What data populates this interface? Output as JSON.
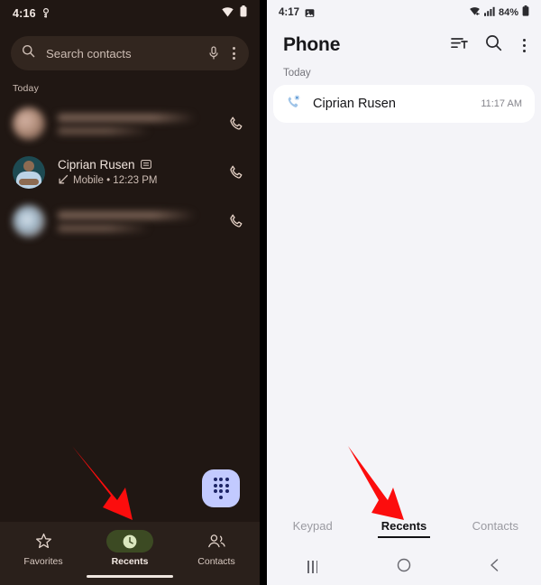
{
  "left_phone": {
    "status_bar": {
      "time": "4:16",
      "left_icon": "alarm-or-key-icon",
      "wifi_icon": "wifi-icon",
      "battery_icon": "battery-icon"
    },
    "search": {
      "placeholder": "Search contacts",
      "search_icon": "search-icon",
      "mic_icon": "microphone-icon",
      "overflow_icon": "more-vert-icon"
    },
    "section_header": "Today",
    "calls": [
      {
        "name": "",
        "subtitle": "",
        "blurred": true,
        "avatar": "blurred-avatar",
        "action_icon": "phone-icon"
      },
      {
        "name": "Ciprian Rusen",
        "badge_icon": "sim-card-icon",
        "direction_icon": "incoming-call-arrow",
        "subtitle": "Mobile • 12:23 PM",
        "blurred": false,
        "avatar": "contact-photo",
        "action_icon": "phone-icon"
      },
      {
        "name": "",
        "subtitle": "",
        "blurred": true,
        "avatar": "blurred-avatar",
        "action_icon": "phone-icon"
      }
    ],
    "fab": {
      "icon": "dialpad-icon",
      "color": "#c2caff"
    },
    "bottom_nav": [
      {
        "label": "Favorites",
        "icon": "star-icon",
        "active": false
      },
      {
        "label": "Recents",
        "icon": "clock-icon",
        "active": true
      },
      {
        "label": "Contacts",
        "icon": "people-icon",
        "active": false
      }
    ],
    "active_pill_color": "#3c4a23",
    "background_color": "#201713"
  },
  "right_phone": {
    "status_bar": {
      "time": "4:17",
      "left_icon": "screenshot-icon",
      "wifi_icon": "wifi-icon",
      "signal_icon": "cellular-signal-icon",
      "battery_text": "84%",
      "battery_icon": "battery-icon"
    },
    "header": {
      "title": "Phone",
      "sort_icon": "sort-icon",
      "search_icon": "search-icon",
      "overflow_icon": "more-vert-icon"
    },
    "section_header": "Today",
    "calls": [
      {
        "icon": "missed-call-icon",
        "name": "Ciprian Rusen",
        "time": "11:17 AM"
      }
    ],
    "tabs": [
      {
        "label": "Keypad",
        "active": false
      },
      {
        "label": "Recents",
        "active": true
      },
      {
        "label": "Contacts",
        "active": false
      }
    ],
    "nav_bar": [
      {
        "icon": "recents-nav-icon"
      },
      {
        "icon": "home-nav-icon"
      },
      {
        "icon": "back-nav-icon"
      }
    ],
    "background_color": "#f4f4f8"
  },
  "annotations": {
    "arrow_color": "#fc0d0d",
    "arrows": [
      {
        "name": "arrow-pointing-to-recents-left",
        "target": "Recents"
      },
      {
        "name": "arrow-pointing-to-recents-right",
        "target": "Recents"
      }
    ]
  }
}
